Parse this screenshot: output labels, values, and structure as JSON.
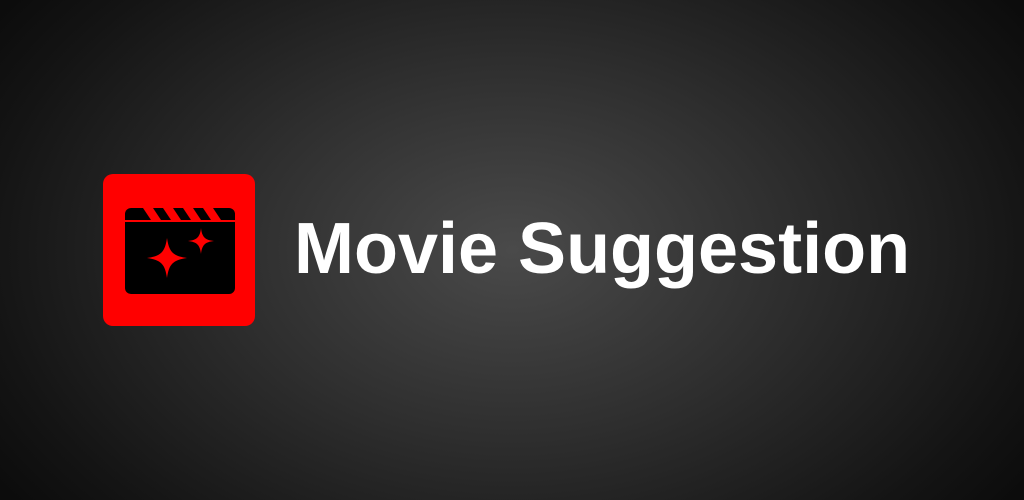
{
  "app": {
    "title": "Movie Suggestion",
    "icon": "clapperboard-sparkle-icon"
  },
  "colors": {
    "brand": "#ff0000",
    "icon_foreground": "#000000",
    "title_text": "#ffffff",
    "background": "#2e2e2e"
  }
}
